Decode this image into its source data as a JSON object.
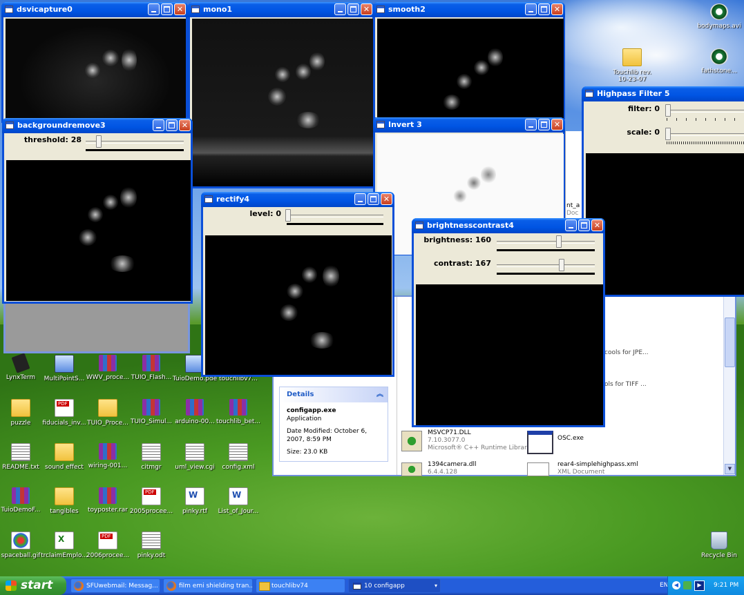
{
  "windows": {
    "dsvicapture": {
      "title": "dsvicapture0"
    },
    "mono": {
      "title": "mono1"
    },
    "smooth": {
      "title": "smooth2"
    },
    "bgremove": {
      "title": "backgroundremove3",
      "threshold_label": "threshold: 28",
      "threshold_value": 28
    },
    "invert": {
      "title": "Invert 3"
    },
    "highpass": {
      "title": "Highpass Filter 5",
      "filter_label": "filter: 0",
      "scale_label": "scale: 0"
    },
    "rectify": {
      "title": "rectify4",
      "level_label": "level: 0"
    },
    "brightness": {
      "title": "brightnesscontrast4",
      "brightness_label": "brightness: 160",
      "contrast_label": "contrast: 167"
    }
  },
  "explorer": {
    "details_title": "Details",
    "file_name": "configapp.exe",
    "file_type": "Application",
    "date_modified": "Date Modified: October 6, 2007, 8:59 PM",
    "size": "Size: 23.0 KB",
    "files": [
      {
        "name": "MSVCP71.DLL",
        "sub1": "7.10.3077.0",
        "sub2": "Microsoft® C++ Runtime Library"
      },
      {
        "name": "OSC.exe",
        "sub1": "",
        "sub2": ""
      },
      {
        "name": "1394camera.dll",
        "sub1": "6.4.4.128",
        "sub2": ""
      },
      {
        "name": "rear4-simplehighpass.xml",
        "sub1": "XML Document",
        "sub2": ""
      }
    ],
    "partial1": "cools for JPE...",
    "partial2": "ols for TIFF ...",
    "partial3": "nt_a",
    "partial4": "Doc"
  },
  "desktop_icons": [
    {
      "label": "LynxTerm",
      "type": "chip"
    },
    {
      "label": "MultiPointS...",
      "type": "app"
    },
    {
      "label": "WWV_proce...",
      "type": "rar"
    },
    {
      "label": "TUIO_Flash...",
      "type": "rar"
    },
    {
      "label": "TuioDemo.pde",
      "type": "app"
    },
    {
      "label": "touchlibv7...",
      "type": "app"
    },
    {
      "label": "puzzle",
      "type": "folder"
    },
    {
      "label": "fiducials_inv...",
      "type": "pdf"
    },
    {
      "label": "TUIO_Proce...",
      "type": "folder"
    },
    {
      "label": "TUIO_Simul...",
      "type": "rar"
    },
    {
      "label": "arduino-00...",
      "type": "rar"
    },
    {
      "label": "touchlib_bet...",
      "type": "rar"
    },
    {
      "label": "README.txt",
      "type": "txt"
    },
    {
      "label": "sound effect",
      "type": "folder"
    },
    {
      "label": "wiring-001...",
      "type": "rar"
    },
    {
      "label": "citmgr",
      "type": "txt"
    },
    {
      "label": "uml_view.cgi",
      "type": "txt"
    },
    {
      "label": "config.xml",
      "type": "txt"
    },
    {
      "label": "TuioDemoF...",
      "type": "rar"
    },
    {
      "label": "tangibles",
      "type": "folder"
    },
    {
      "label": "toyposter.rar",
      "type": "rar"
    },
    {
      "label": "2005procee...",
      "type": "pdf"
    },
    {
      "label": "pinky.rtf",
      "type": "doc"
    },
    {
      "label": "List_of_Jour...",
      "type": "doc"
    },
    {
      "label": "spaceball.gif",
      "type": "gif"
    },
    {
      "label": "trclaimEmplo...",
      "type": "xls"
    },
    {
      "label": "2006procee...",
      "type": "pdf"
    },
    {
      "label": "pinky.odt",
      "type": "txt"
    }
  ],
  "right_icons": [
    {
      "label": "bodymaps.avi"
    },
    {
      "label": "Touchlib rev. 10-23-07"
    },
    {
      "label": "fathstone..."
    },
    {
      "label": "Recycle Bin"
    }
  ],
  "taskbar": {
    "start_label": "start",
    "tasks": [
      {
        "label": "SFUwebmail: Messag..."
      },
      {
        "label": "film emi shielding tran..."
      },
      {
        "label": "touchlibv74"
      },
      {
        "label": "10 configapp"
      }
    ],
    "lang": "EN",
    "time": "9:21 PM"
  }
}
